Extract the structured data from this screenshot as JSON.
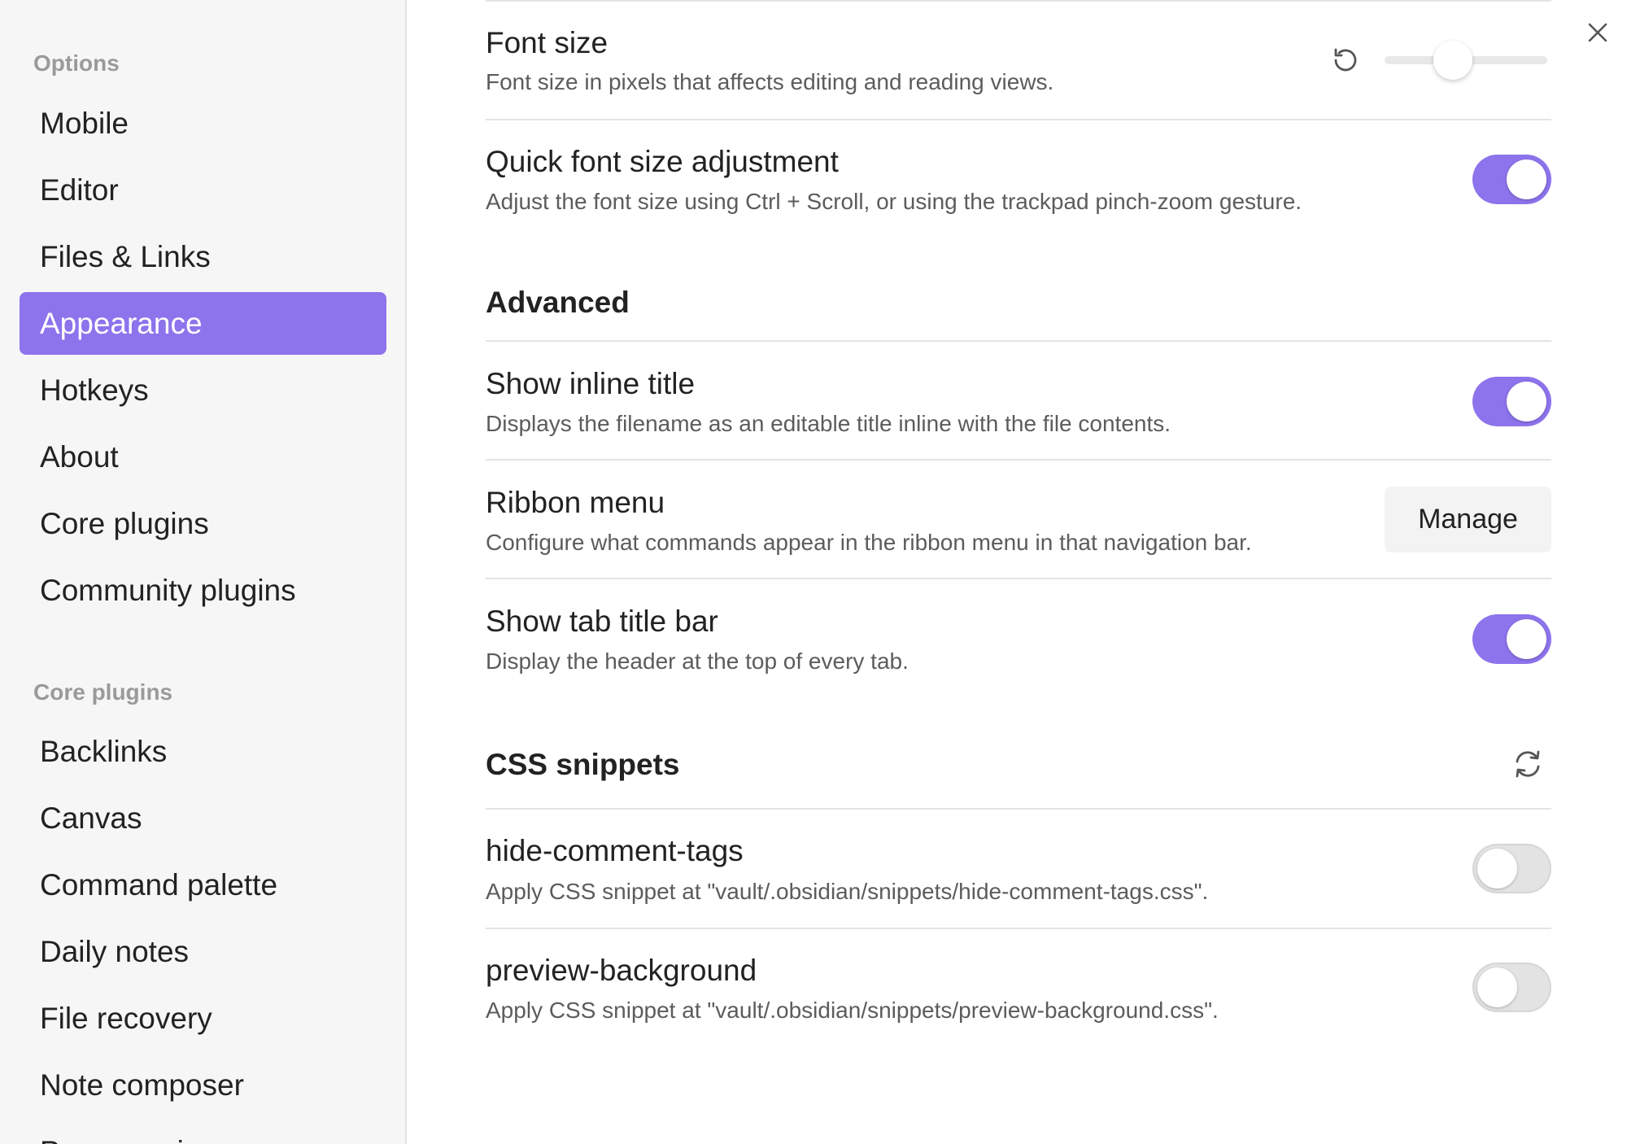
{
  "sidebar": {
    "options_heading": "Options",
    "options_items": [
      {
        "label": "Mobile",
        "active": false
      },
      {
        "label": "Editor",
        "active": false
      },
      {
        "label": "Files & Links",
        "active": false
      },
      {
        "label": "Appearance",
        "active": true
      },
      {
        "label": "Hotkeys",
        "active": false
      },
      {
        "label": "About",
        "active": false
      },
      {
        "label": "Core plugins",
        "active": false
      },
      {
        "label": "Community plugins",
        "active": false
      }
    ],
    "core_plugins_heading": "Core plugins",
    "core_plugins_items": [
      {
        "label": "Backlinks"
      },
      {
        "label": "Canvas"
      },
      {
        "label": "Command palette"
      },
      {
        "label": "Daily notes"
      },
      {
        "label": "File recovery"
      },
      {
        "label": "Note composer"
      },
      {
        "label": "Page preview"
      }
    ]
  },
  "settings": {
    "font_size": {
      "name": "Font size",
      "desc": "Font size in pixels that affects editing and reading views.",
      "slider_fraction": 0.42,
      "reset_icon": "reset-icon"
    },
    "quick_font": {
      "name": "Quick font size adjustment",
      "desc": "Adjust the font size using Ctrl + Scroll, or using the trackpad pinch-zoom gesture.",
      "enabled": true
    },
    "advanced_heading": "Advanced",
    "inline_title": {
      "name": "Show inline title",
      "desc": "Displays the filename as an editable title inline with the file contents.",
      "enabled": true
    },
    "ribbon_menu": {
      "name": "Ribbon menu",
      "desc": "Configure what commands appear in the ribbon menu in that navigation bar.",
      "button_label": "Manage"
    },
    "tab_title_bar": {
      "name": "Show tab title bar",
      "desc": "Display the header at the top of every tab.",
      "enabled": true
    },
    "css_heading": "CSS snippets",
    "reload_icon": "reload-icon",
    "snippets": [
      {
        "name": "hide-comment-tags",
        "desc": "Apply CSS snippet at \"vault/.obsidian/snippets/hide-comment-tags.css\".",
        "enabled": false
      },
      {
        "name": "preview-background",
        "desc": "Apply CSS snippet at \"vault/.obsidian/snippets/preview-background.css\".",
        "enabled": false
      }
    ]
  },
  "colors": {
    "accent": "#8d73ec",
    "sidebar_bg": "#f6f6f6",
    "toggle_off": "#e3e3e3"
  },
  "close_icon": "close-icon"
}
